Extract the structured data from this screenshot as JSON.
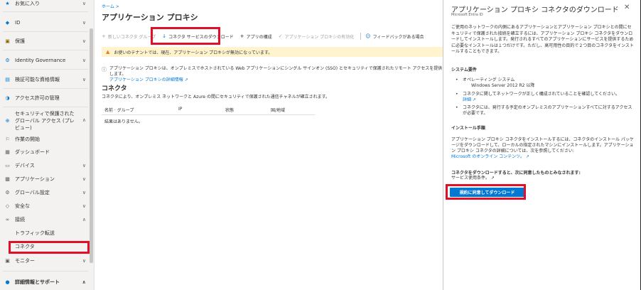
{
  "sidebar": {
    "items": [
      {
        "label": "お気に入り",
        "icon": "star-icon",
        "glyph": "★"
      },
      {
        "label": "ID",
        "icon": "identity-icon",
        "glyph": "◆"
      },
      {
        "label": "保護",
        "icon": "lock-icon",
        "glyph": "🔒"
      },
      {
        "label": "Identity Governance",
        "icon": "governance-icon",
        "glyph": "⚙"
      },
      {
        "label": "検証可能な資格情報",
        "icon": "credential-icon",
        "glyph": "▤"
      },
      {
        "label": "アクセス許可の管理",
        "icon": "permissions-icon",
        "glyph": "◑"
      },
      {
        "label_line1": "セキュリティで保護された",
        "label_line2": "グローバル アクセス (プレ",
        "label_line3": "ビュー)",
        "icon": "globe-icon",
        "glyph": "⊕"
      },
      {
        "label": "作業の開始",
        "icon": "rocket-icon",
        "glyph": "⚐"
      },
      {
        "label": "ダッシュボード",
        "icon": "dashboard-icon",
        "glyph": "▦"
      },
      {
        "label": "デバイス",
        "icon": "device-icon",
        "glyph": "▭"
      },
      {
        "label": "アプリケーション",
        "icon": "apps-icon",
        "glyph": "▩"
      },
      {
        "label": "グローバル設定",
        "icon": "gear-icon",
        "glyph": "⚙"
      },
      {
        "label": "安全な",
        "icon": "shield-icon",
        "glyph": "⛨"
      },
      {
        "label": "接続",
        "icon": "link-icon",
        "glyph": "⚭"
      },
      {
        "label": "トラフィック転送",
        "icon": "",
        "glyph": ""
      },
      {
        "label": "コネクタ",
        "icon": "",
        "glyph": ""
      },
      {
        "label": "モニター",
        "icon": "monitor-icon",
        "glyph": "▣"
      },
      {
        "label": "詳細情報とサポート",
        "icon": "person-icon",
        "glyph": "👤"
      }
    ]
  },
  "main": {
    "breadcrumb": "ホーム >",
    "title": "アプリケーション プロキシ",
    "title_more": "…",
    "toolbar": {
      "new_group": "新しいコネクタ グループ",
      "download": "コネクタ サービスのダウンロード",
      "configure": "アプリの構成",
      "enable": "アプリケーション プロキシの有効化",
      "feedback": "フィードバックがある場合"
    },
    "warning": "お使いのテナントでは、現在、アプリケーション プロキシが無効になっています。",
    "info_text": "アプリケーション プロキシは、オンプレミスでホストされている Web アプリケーションにシングル サインオン (SSO) とセキュリティで保護されたリモート アクセスを提供します。",
    "info_link": "アプリケーション プロキシの詳細情報 ↗",
    "section_title": "コネクタ",
    "section_desc": "コネクタにより、オンプレミス ネットワークと Azure の間にセキュリティで保護された通信チャネルが確立されます。",
    "table": {
      "headers": [
        "名前 · グループ",
        "IP",
        "状態",
        "国/地域"
      ],
      "empty": "結果はありません。"
    }
  },
  "panel": {
    "title": "アプリケーション プロキシ コネクタのダウンロード",
    "subtitle": "Microsoft Entra ID",
    "close": "✕",
    "intro": "ご使用のネットワークの内側にあるアプリケーションとアプリケーション プロキシとの間にセキュリティで保護された接続を確立するには、アプリケーション プロキシ コネクタをダウンロードしてインストールします。発行されるすべてのアプリケーションにサービスを提供するために必要なインストールは１つだけです。ただし、高可用性の目的で２つ目のコネクタをインストールすることもできます。",
    "sysreq_title": "システム要件",
    "req1": "オペレーティング システム",
    "req1_sub": "Windows Server 2012 R2 以降",
    "req2": "コネクタに関してネットワークが正しく構成されていることを確認してください。",
    "req2_link": "詳細 ↗",
    "req3": "コネクタには、発行する予定のオンプレミスのアプリケーションすべてに対するアクセスが必要です。",
    "install_title": "インストール手順",
    "install_text": "アプリケーション プロキシ コネクタをインストールするには、コネクタのインストール パッケージをダウンロードして、ローカルの指定されたマシンにインストールします。アプリケーション プロキシ コネクタの詳細については、次を参照してください:",
    "install_link": "Microsoft のオンライン コンテンツ。 ↗",
    "agree_title": "コネクタをダウンロードすると、次に同意したものとみなされます:",
    "terms_link": "サービス使用条件。 ↗",
    "download_button": "規約に同意してダウンロード"
  },
  "colors": {
    "accent": "#0078d4",
    "highlight": "#e0102a",
    "warning_bg": "#fff4ce"
  }
}
